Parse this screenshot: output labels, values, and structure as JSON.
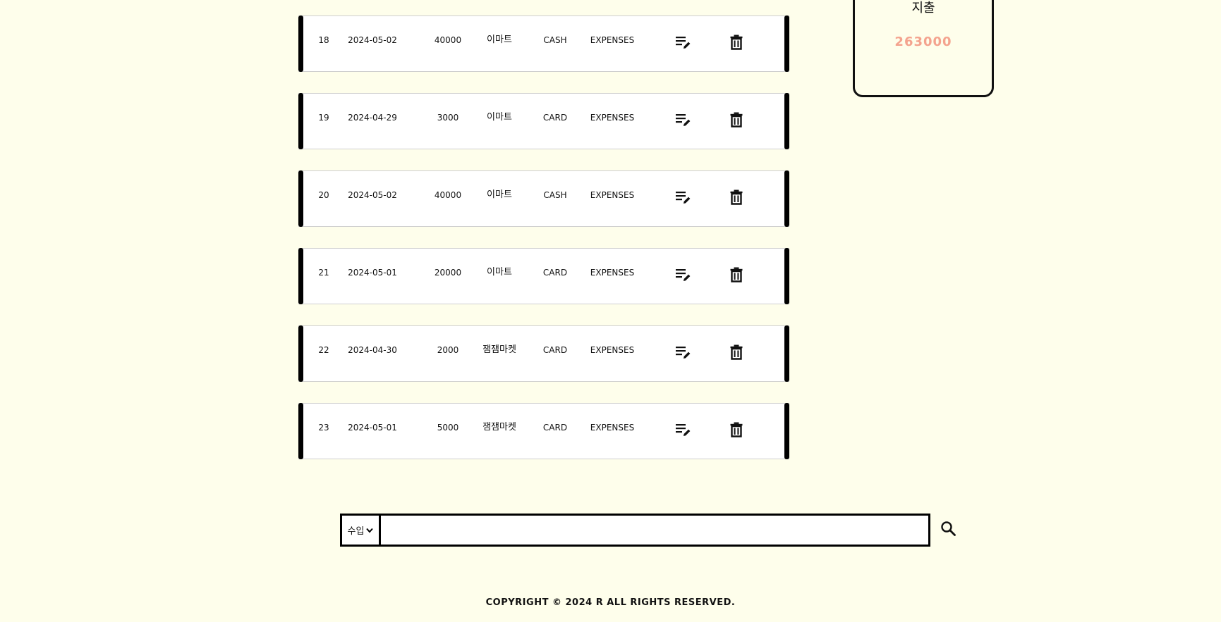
{
  "records": [
    {
      "id": "18",
      "date": "2024-05-02",
      "amount": "40000",
      "place": "이마트",
      "method": "CASH",
      "type": "EXPENSES"
    },
    {
      "id": "19",
      "date": "2024-04-29",
      "amount": "3000",
      "place": "이마트",
      "method": "CARD",
      "type": "EXPENSES"
    },
    {
      "id": "20",
      "date": "2024-05-02",
      "amount": "40000",
      "place": "이마트",
      "method": "CASH",
      "type": "EXPENSES"
    },
    {
      "id": "21",
      "date": "2024-05-01",
      "amount": "20000",
      "place": "이마트",
      "method": "CARD",
      "type": "EXPENSES"
    },
    {
      "id": "22",
      "date": "2024-04-30",
      "amount": "2000",
      "place": "잼잼마켓",
      "method": "CARD",
      "type": "EXPENSES"
    },
    {
      "id": "23",
      "date": "2024-05-01",
      "amount": "5000",
      "place": "잼잼마켓",
      "method": "CARD",
      "type": "EXPENSES"
    }
  ],
  "row_icons": {
    "edit": "edit-note-icon",
    "delete": "trash-icon"
  },
  "summary": {
    "label": "지출",
    "value": "263000",
    "value_color": "#f4a38e"
  },
  "search": {
    "category_selected": "수입",
    "input_value": "",
    "button_icon": "search-icon"
  },
  "footer": {
    "text": "COPYRIGHT © 2024 R ALL RIGHTS RESERVED."
  }
}
